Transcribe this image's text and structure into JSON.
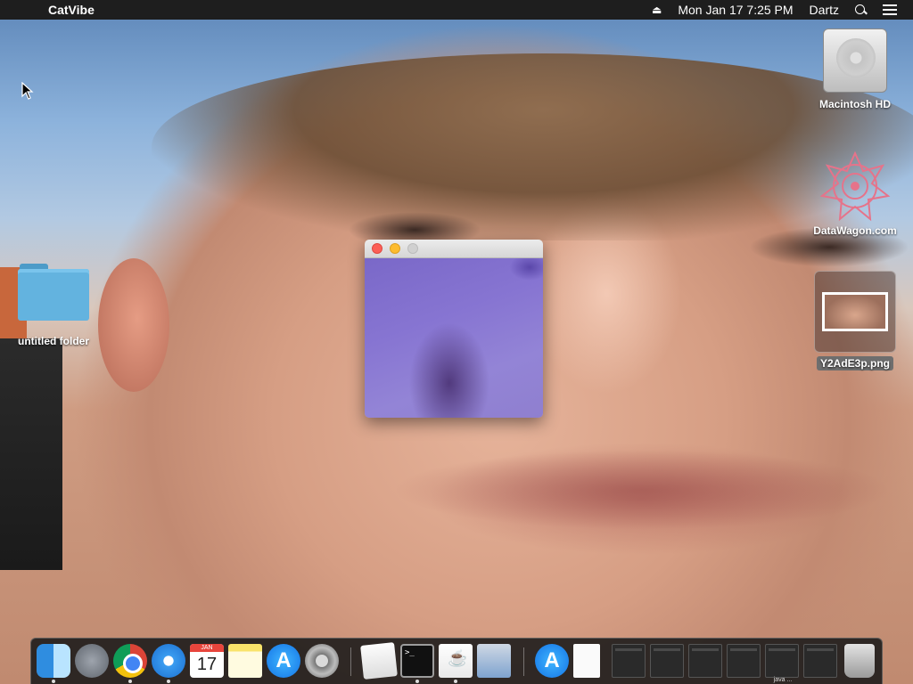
{
  "menubar": {
    "apple_glyph": "",
    "app_name": "CatVibe",
    "datetime": "Mon Jan 17  7:25 PM",
    "user": "Dartz"
  },
  "desktop": {
    "items": [
      {
        "label": "Macintosh HD",
        "icon": "hard-drive-icon"
      },
      {
        "label": "DataWagon.com",
        "icon": "datawagon-logo-icon"
      },
      {
        "label": "untitled folder",
        "icon": "folder-icon"
      },
      {
        "label": "Y2AdE3p.png",
        "icon": "image-file-icon"
      }
    ]
  },
  "dock": {
    "calendar_month": "JAN",
    "calendar_day": "17",
    "terminal_prompt": ">_",
    "thumb_label": "java ..."
  }
}
